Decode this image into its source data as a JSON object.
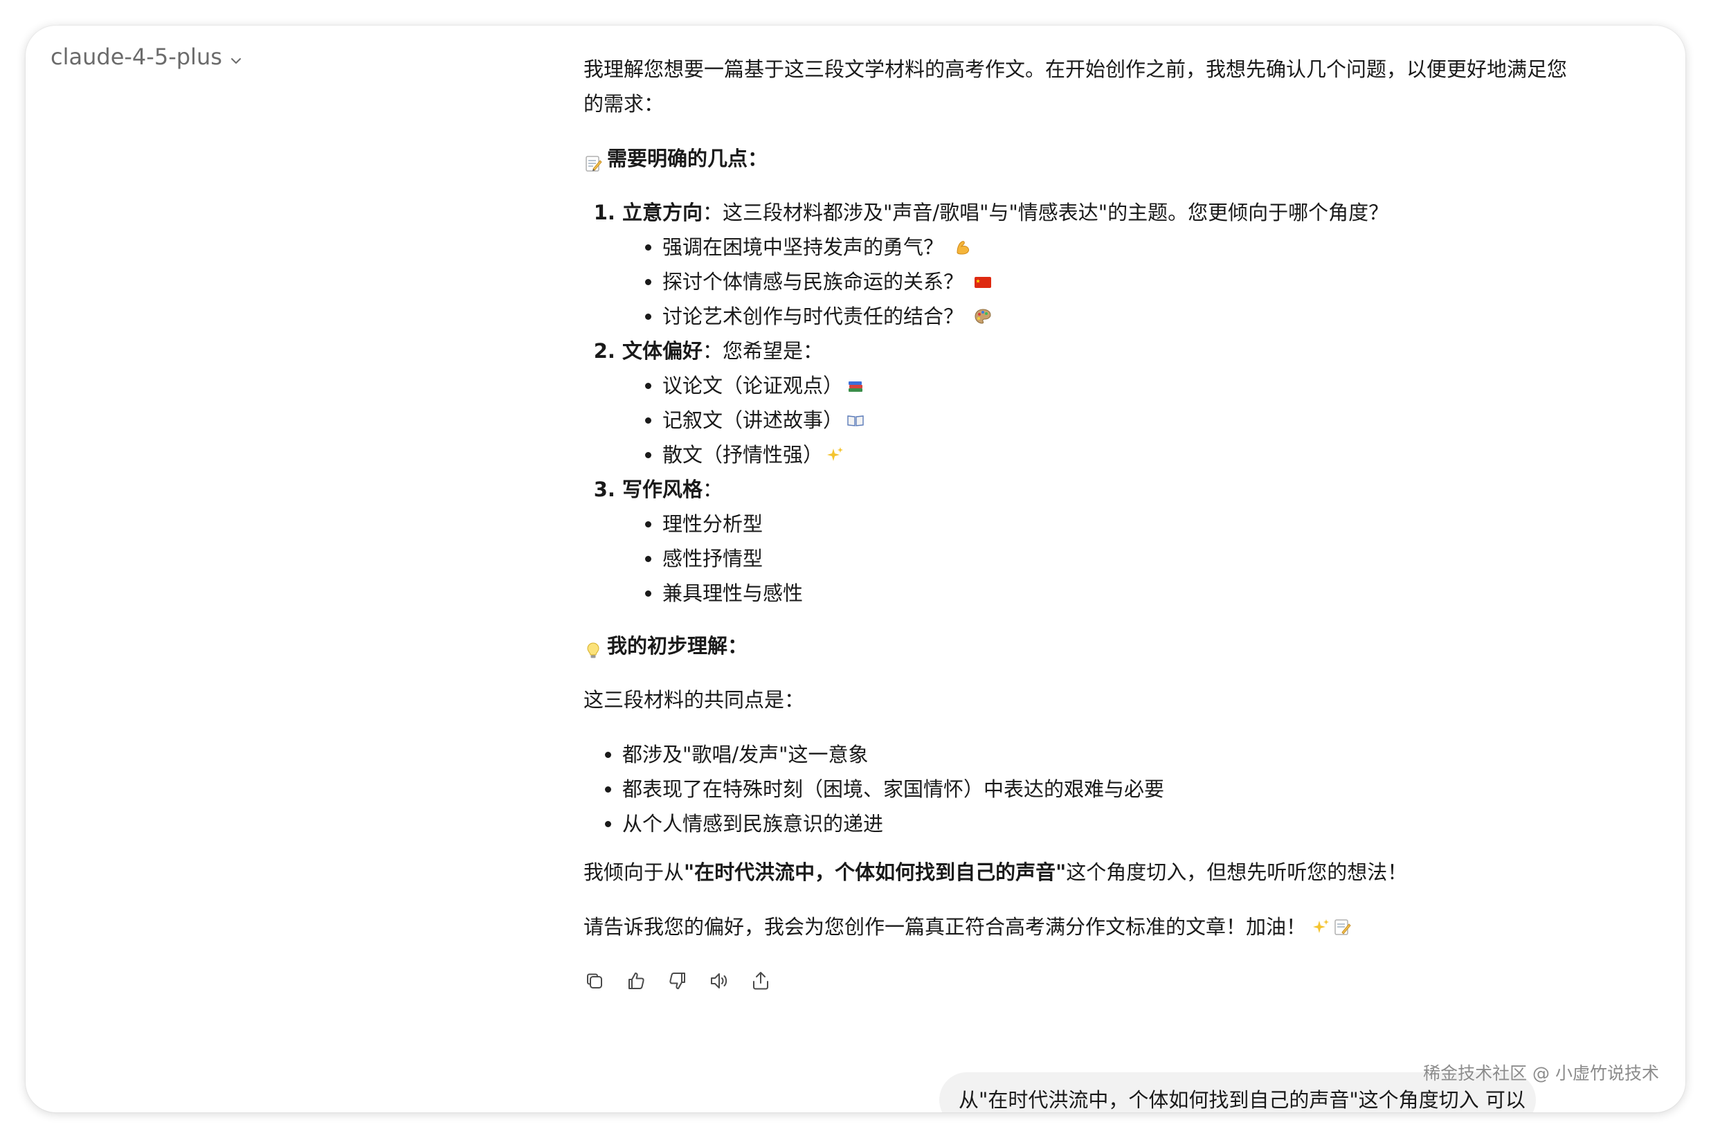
{
  "model_selector": {
    "label": "claude-4-5-plus",
    "icon": "chevron-down-icon"
  },
  "response": {
    "intro": "我理解您想要一篇基于这三段文学材料的高考作文。在开始创作之前，我想先确认几个问题，以便更好地满足您的需求：",
    "questions_heading": "需要明确的几点：",
    "questions": [
      {
        "title": "立意方向",
        "text": "：这三段材料都涉及\"声音/歌唱\"与\"情感表达\"的主题。您更倾向于哪个角度？",
        "options": [
          "强调在困境中坚持发声的勇气？",
          "探讨个体情感与民族命运的关系？",
          "讨论艺术创作与时代责任的结合？"
        ]
      },
      {
        "title": "文体偏好",
        "text": "：您希望是：",
        "options": [
          "议论文（论证观点）",
          "记叙文（讲述故事）",
          "散文（抒情性强）"
        ]
      },
      {
        "title": "写作风格",
        "text": "：",
        "options": [
          "理性分析型",
          "感性抒情型",
          "兼具理性与感性"
        ]
      }
    ],
    "understanding_heading": "我的初步理解：",
    "common_intro": "这三段材料的共同点是：",
    "common_points": [
      "都涉及\"歌唱/发声\"这一意象",
      "都表现了在特殊时刻（困境、家国情怀）中表达的艰难与必要",
      "从个人情感到民族意识的递进"
    ],
    "tendency_prefix": "我倾向于从",
    "tendency_bold": "\"在时代洪流中，个体如何找到自己的声音\"",
    "tendency_suffix": "这个角度切入，但想先听听您的想法！",
    "closing": "请告诉我您的偏好，我会为您创作一篇真正符合高考满分作文标准的文章！加油！"
  },
  "action_bar": {
    "icons": [
      "copy-icon",
      "thumbs-up-icon",
      "thumbs-down-icon",
      "speaker-icon",
      "share-icon"
    ]
  },
  "user_message": {
    "text": "从\"在时代洪流中，个体如何找到自己的声音\"这个角度切入 可以"
  },
  "watermark": {
    "text": "稀金技术社区 @ 小虚竹说技术"
  },
  "emoji_icons": [
    "memo-icon",
    "flexed-biceps-icon",
    "china-flag-icon",
    "palette-icon",
    "books-icon",
    "open-book-icon",
    "sparkles-icon",
    "light-bulb-icon"
  ]
}
